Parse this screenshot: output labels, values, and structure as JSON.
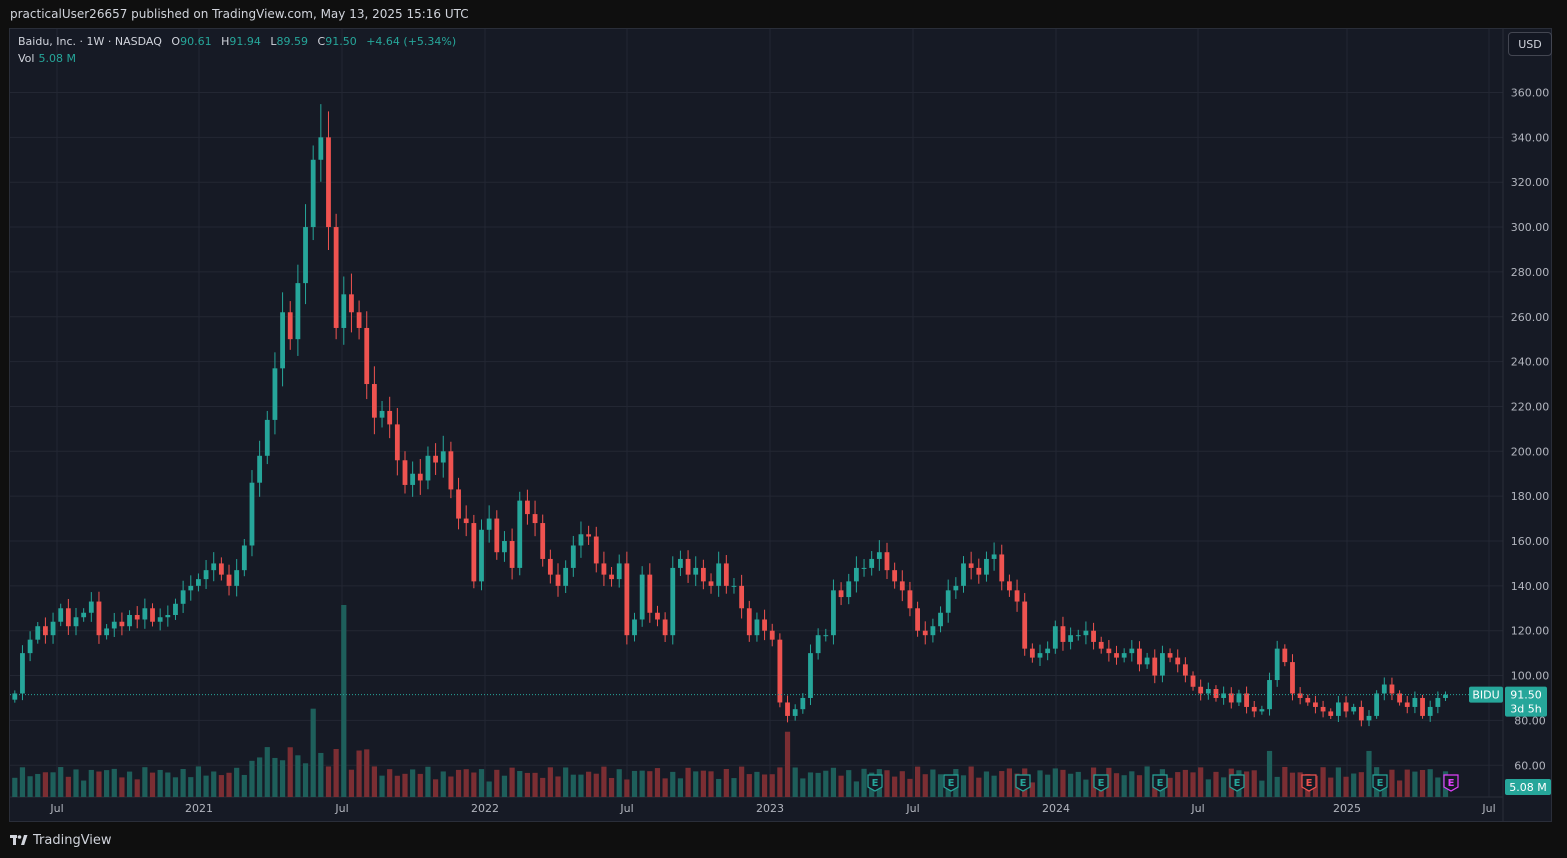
{
  "header": {
    "published_text": "practicalUser26657 published on TradingView.com, May 13, 2025 15:16 UTC"
  },
  "legend": {
    "symbol": "Baidu, Inc. · 1W · NASDAQ",
    "open_label": "O",
    "open": "90.61",
    "high_label": "H",
    "high": "91.94",
    "low_label": "L",
    "low": "89.59",
    "close_label": "C",
    "close": "91.50",
    "change": "+4.64 (+5.34%)",
    "vol_label": "Vol",
    "vol": "5.08 M"
  },
  "toolbar": {
    "currency_button": "USD"
  },
  "price_tags": {
    "symbol": "BIDU",
    "last_price": "91.50",
    "countdown": "3d 5h",
    "volume": "5.08 M"
  },
  "footer": {
    "brand": "TradingView"
  },
  "colors": {
    "up": "#26a69a",
    "down": "#ef5350",
    "vol_up": "#1e5f5b",
    "vol_down": "#7b2e33",
    "earnings_past": "#26a69a",
    "earnings_down": "#ef5350",
    "earnings_future": "#e040fb"
  },
  "chart_data": {
    "type": "candlestick",
    "title": "Baidu, Inc. · 1W · NASDAQ",
    "timeframe": "1W",
    "y_axis": {
      "side": "right",
      "ticks": [
        60,
        80,
        100,
        120,
        140,
        160,
        180,
        200,
        220,
        240,
        260,
        280,
        300,
        320,
        340,
        360
      ],
      "range": [
        46,
        380
      ]
    },
    "x_axis": {
      "ticks": [
        "Jul",
        "2021",
        "Jul",
        "2022",
        "Jul",
        "2023",
        "Jul",
        "2024",
        "Jul",
        "2025",
        "Jul"
      ]
    },
    "last_close": 91.5,
    "close_series": {
      "description": "approximate weekly closes read from the chart",
      "start": "2020-05-18",
      "values": [
        92,
        110,
        116,
        122,
        118,
        124,
        130,
        122,
        126,
        128,
        133,
        118,
        121,
        124,
        122,
        127,
        125,
        130,
        124,
        126,
        127,
        132,
        138,
        140,
        143,
        147,
        150,
        145,
        140,
        147,
        158,
        186,
        198,
        214,
        237,
        262,
        250,
        275,
        300,
        330,
        340,
        300,
        255,
        270,
        262,
        255,
        230,
        215,
        218,
        212,
        196,
        185,
        190,
        187,
        198,
        195,
        200,
        183,
        170,
        168,
        142,
        165,
        170,
        155,
        160,
        148,
        178,
        172,
        168,
        152,
        145,
        140,
        148,
        158,
        163,
        162,
        150,
        145,
        143,
        150,
        118,
        125,
        145,
        128,
        125,
        118,
        148,
        152,
        145,
        148,
        142,
        140,
        150,
        140,
        140,
        130,
        118,
        125,
        120,
        116,
        88,
        82,
        85,
        90,
        110,
        118,
        118,
        138,
        135,
        142,
        148,
        148,
        152,
        155,
        147,
        142,
        138,
        130,
        120,
        118,
        122,
        128,
        138,
        140,
        150,
        148,
        145,
        152,
        154,
        142,
        138,
        133,
        112,
        108,
        110,
        112,
        122,
        115,
        118,
        118,
        120,
        115,
        112,
        110,
        108,
        110,
        112,
        105,
        108,
        100,
        110,
        108,
        105,
        100,
        95,
        92,
        94,
        90,
        92,
        88,
        92,
        86,
        84,
        85,
        98,
        112,
        106,
        92,
        90,
        88,
        86,
        84,
        82,
        88,
        84,
        86,
        80,
        82,
        92,
        96,
        92,
        88,
        86,
        90,
        82,
        86,
        90,
        91.5
      ]
    },
    "highlights": {
      "all_time_high_approx": 354.82,
      "peak_period": "2021 Q1"
    },
    "volume_series": {
      "description": "relative weekly volume, tallest spike in early 2021",
      "spikes": [
        {
          "period": "2021 Feb-Mar",
          "relative": 1.0
        },
        {
          "period": "2021 Jan",
          "relative": 0.46
        },
        {
          "period": "2022 Apr",
          "relative": 0.34
        },
        {
          "period": "2024 Jul",
          "relative": 0.24
        },
        {
          "period": "2024 Oct",
          "relative": 0.24
        },
        {
          "period": "2025 Mar",
          "relative": 0.24
        }
      ]
    },
    "earnings_markers": [
      "past",
      "past",
      "past",
      "past",
      "past",
      "past",
      "down",
      "past",
      "upcoming"
    ],
    "grid": true,
    "legend_position": "top-left"
  }
}
